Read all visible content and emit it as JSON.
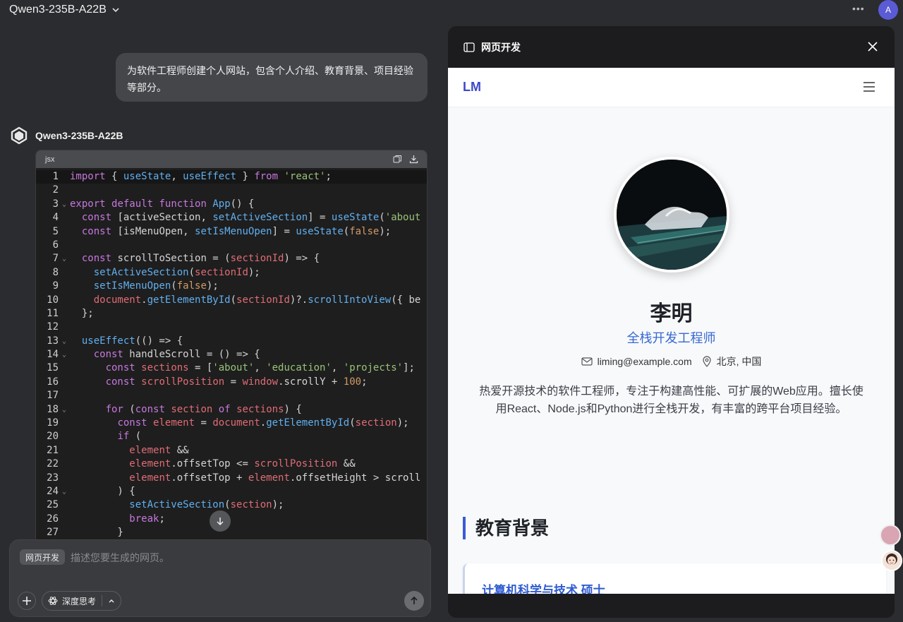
{
  "header": {
    "model_name": "Qwen3-235B-A22B",
    "more_icon": "more-horizontal-icon",
    "avatar_letter": "A"
  },
  "chat": {
    "user_message": "为软件工程师创建个人网站，包含个人介绍、教育背景、项目经验等部分。",
    "assistant_name": "Qwen3-235B-A22B",
    "code_block": {
      "language": "jsx",
      "lines": [
        "import { useState, useEffect } from 'react';",
        "",
        "export default function App() {",
        "  const [activeSection, setActiveSection] = useState('about",
        "  const [isMenuOpen, setIsMenuOpen] = useState(false);",
        "",
        "  const scrollToSection = (sectionId) => {",
        "    setActiveSection(sectionId);",
        "    setIsMenuOpen(false);",
        "    document.getElementById(sectionId)?.scrollIntoView({ be",
        "  };",
        "",
        "  useEffect(() => {",
        "    const handleScroll = () => {",
        "      const sections = ['about', 'education', 'projects'];",
        "      const scrollPosition = window.scrollY + 100;",
        "",
        "      for (const section of sections) {",
        "        const element = document.getElementById(section);",
        "        if (",
        "          element &&",
        "          element.offsetTop <= scrollPosition &&",
        "          element.offsetTop + element.offsetHeight > scroll",
        "        ) {",
        "          setActiveSection(section);",
        "          break;",
        "        }"
      ],
      "line_numbers": [
        "1",
        "2",
        "3",
        "4",
        "5",
        "6",
        "7",
        "8",
        "9",
        "10",
        "11",
        "12",
        "13",
        "14",
        "15",
        "16",
        "17",
        "18",
        "19",
        "20",
        "21",
        "22",
        "23",
        "24",
        "25",
        "26",
        "27"
      ]
    }
  },
  "composer": {
    "mode_chip": "网页开发",
    "placeholder": "描述您要生成的网页。",
    "deep_think_label": "深度思考"
  },
  "panel": {
    "title": "网页开发",
    "preview": {
      "logo": "LM",
      "name": "李明",
      "job_title": "全栈开发工程师",
      "email": "liming@example.com",
      "location": "北京, 中国",
      "bio": "热爱开源技术的软件工程师，专注于构建高性能、可扩展的Web应用。擅长使用React、Node.js和Python进行全栈开发，有丰富的跨平台项目经验。",
      "section_title": "教育背景",
      "degree": "计算机科学与技术 硕士"
    }
  },
  "colors": {
    "accent": "#3b5bd6",
    "dark_bg": "#2b2c2f",
    "panel_bg": "#1c1c1e"
  }
}
